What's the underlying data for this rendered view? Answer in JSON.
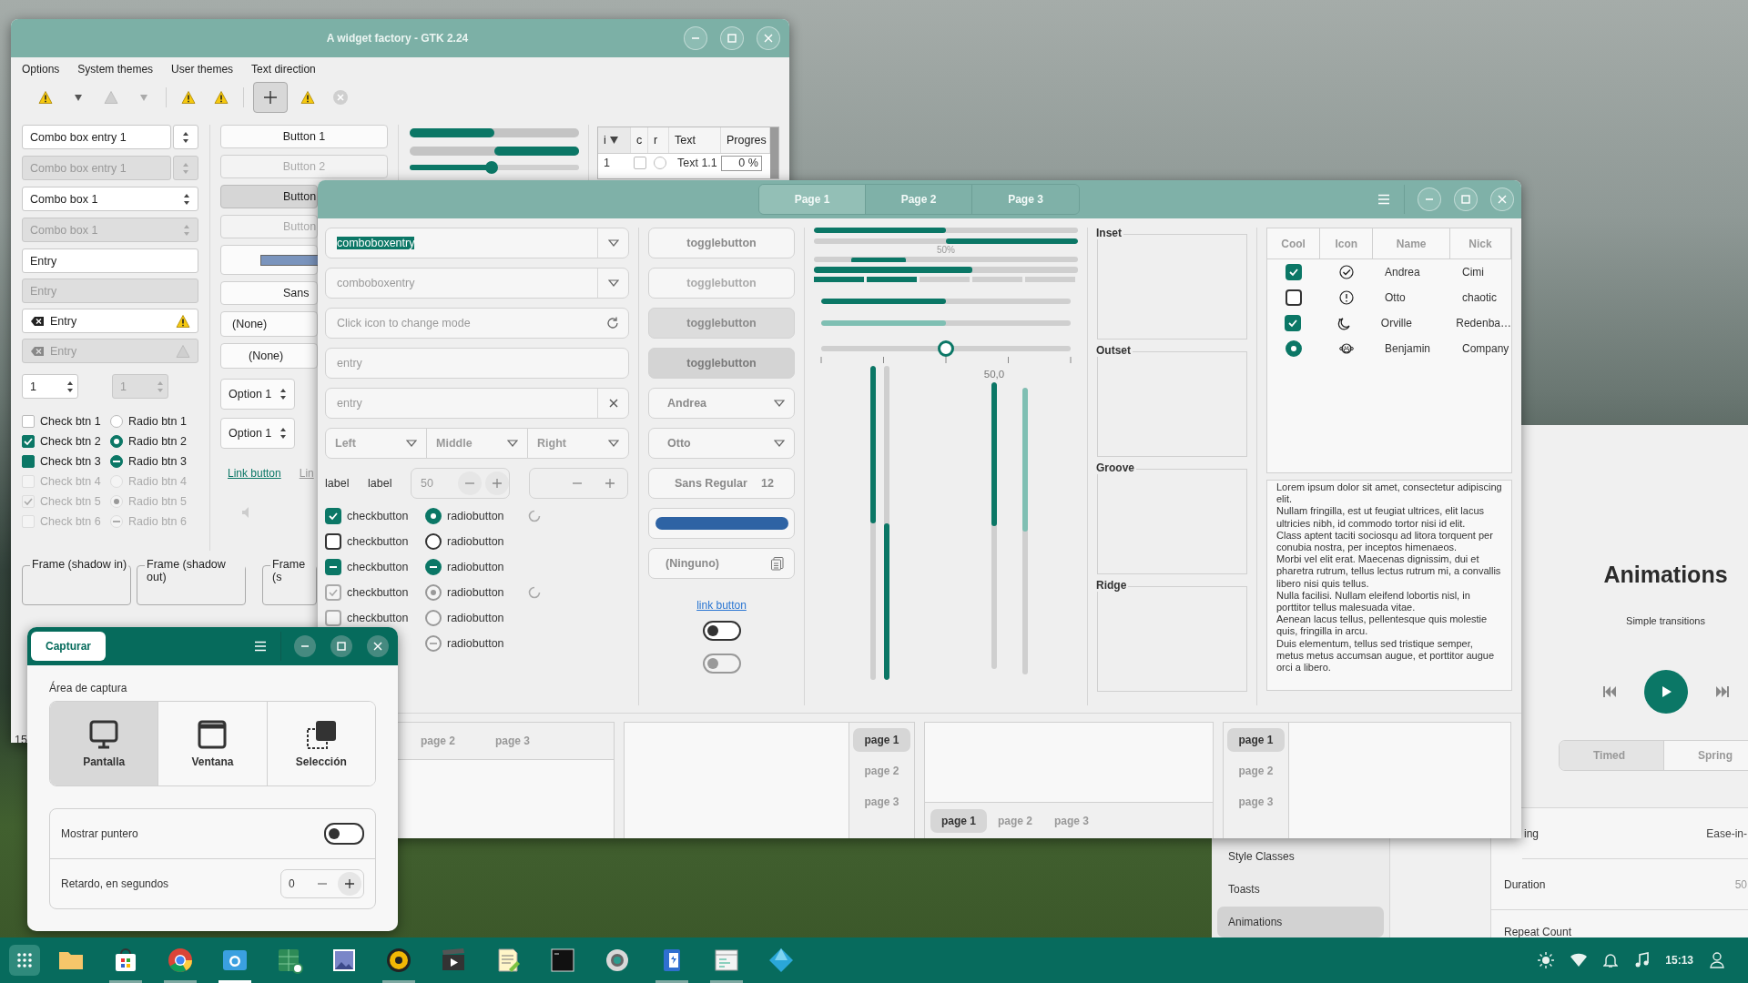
{
  "gtk2_window": {
    "title": "A widget factory - GTK 2.24",
    "menu": [
      "Options",
      "System themes",
      "User themes",
      "Text direction"
    ],
    "combos": [
      {
        "kind": "combo-entry",
        "text": "Combo box entry 1",
        "disabled": false
      },
      {
        "kind": "combo-entry",
        "text": "Combo box entry 1",
        "disabled": true
      },
      {
        "kind": "combo",
        "text": "Combo box 1",
        "disabled": false
      },
      {
        "kind": "combo",
        "text": "Combo box 1",
        "disabled": true
      }
    ],
    "entries": [
      {
        "kind": "plain",
        "text": "Entry",
        "disabled": false
      },
      {
        "kind": "plain",
        "text": "Entry",
        "disabled": true
      },
      {
        "kind": "icons",
        "text": "Entry",
        "disabled": false
      },
      {
        "kind": "icons",
        "text": "Entry",
        "disabled": true
      }
    ],
    "spins": [
      {
        "value": "1",
        "disabled": false
      },
      {
        "value": "1",
        "disabled": true
      }
    ],
    "checks": [
      {
        "kind": "plain",
        "label": "Check btn 1",
        "checked": false,
        "disabled": false
      },
      {
        "kind": "plain",
        "label": "Check btn 2",
        "checked": true,
        "disabled": false
      },
      {
        "kind": "mixed",
        "label": "Check btn 3",
        "disabled": false
      },
      {
        "kind": "plain",
        "label": "Check btn 4",
        "checked": false,
        "disabled": true
      },
      {
        "kind": "plain",
        "label": "Check btn 5",
        "checked": true,
        "disabled": true
      },
      {
        "kind": "plain",
        "label": "Check btn 6",
        "checked": false,
        "disabled": true
      }
    ],
    "radios": [
      {
        "kind": "plain",
        "label": "Radio btn 1",
        "selected": false,
        "disabled": false
      },
      {
        "kind": "plain",
        "label": "Radio btn 2",
        "selected": true,
        "disabled": false
      },
      {
        "kind": "mixed",
        "label": "Radio btn 3",
        "disabled": false
      },
      {
        "kind": "plain",
        "label": "Radio btn 4",
        "selected": false,
        "disabled": true
      },
      {
        "kind": "plain",
        "label": "Radio btn 5",
        "selected": true,
        "disabled": true
      },
      {
        "kind": "mixed",
        "label": "Radio btn 6",
        "disabled": true
      }
    ],
    "buttons": [
      {
        "label": "Button 1",
        "pressed": false,
        "disabled": false
      },
      {
        "label": "Button 2",
        "pressed": false,
        "disabled": true
      },
      {
        "label": "Button",
        "pressed": true,
        "disabled": false
      },
      {
        "label": "Button",
        "pressed": false,
        "disabled": true
      }
    ],
    "font_button": "Sans",
    "choosers": [
      "(None)",
      "(None)"
    ],
    "option_spins": [
      "Option 1",
      "Option 1"
    ],
    "links": [
      {
        "label": "Link button",
        "disabled": false
      },
      {
        "label": "Lin",
        "disabled": true
      }
    ],
    "progress_bars": [
      {
        "level": 0.5,
        "inverted": false
      },
      {
        "level": 0.5,
        "inverted": true
      }
    ],
    "slider": {
      "level": 0.49
    },
    "tree": {
      "columns": [
        {
          "label": "i",
          "sorted": true
        },
        {
          "label": "c",
          "sorted": false
        },
        {
          "label": "r",
          "sorted": false
        },
        {
          "label": "Text",
          "sorted": false
        },
        {
          "label": "Progres",
          "sorted": false
        }
      ],
      "rows": [
        {
          "number": "1",
          "checked": false,
          "selected": false,
          "text": "Text 1.1",
          "progress": "0 %"
        }
      ]
    },
    "frames": [
      "Frame (shadow in)",
      "Frame (shadow out)",
      "Frame (s"
    ],
    "status": "15"
  },
  "gtk3_window": {
    "tabs": [
      {
        "label": "Page 1",
        "selected": true
      },
      {
        "label": "Page 2",
        "selected": false
      },
      {
        "label": "Page 3",
        "selected": false
      }
    ],
    "combo_entries": [
      {
        "text": "comboboxentry",
        "highlighted": true,
        "disabled": false
      },
      {
        "text": "comboboxentry",
        "highlighted": false,
        "disabled": true
      }
    ],
    "mode_entry": {
      "placeholder": "Click icon to change mode"
    },
    "entries": [
      {
        "kind": "plain",
        "placeholder": "entry"
      },
      {
        "kind": "clear",
        "placeholder": "entry"
      }
    ],
    "linked_combos": [
      "Left",
      "Middle",
      "Right"
    ],
    "labels": [
      "label",
      "label"
    ],
    "spins": [
      {
        "value": "50",
        "disabled": false
      },
      {
        "disabled": true
      }
    ],
    "check_rows": [
      {
        "check": {
          "kind": "plain",
          "label": "checkbutton",
          "checked": true,
          "disabled": false
        },
        "radio": {
          "kind": "plain",
          "label": "radiobutton",
          "selected": true,
          "disabled": false
        },
        "spinner": true
      },
      {
        "check": {
          "kind": "plain",
          "label": "checkbutton",
          "checked": false,
          "disabled": false
        },
        "radio": {
          "kind": "plain",
          "label": "radiobutton",
          "selected": false,
          "disabled": false
        },
        "spinner": false
      },
      {
        "check": {
          "kind": "mixed",
          "label": "checkbutton",
          "disabled": false
        },
        "radio": {
          "kind": "mixed",
          "label": "radiobutton",
          "disabled": false
        },
        "spinner": false
      },
      {
        "check": {
          "kind": "plain",
          "label": "checkbutton",
          "checked": true,
          "disabled": true
        },
        "radio": {
          "kind": "plain",
          "label": "radiobutton",
          "selected": true,
          "disabled": true
        },
        "spinner": true
      },
      {
        "check": {
          "kind": "plain",
          "label": "checkbutton",
          "checked": false,
          "disabled": true
        },
        "radio": {
          "kind": "plain",
          "label": "radiobutton",
          "selected": false,
          "disabled": true
        },
        "spinner": false
      },
      {
        "radio": {
          "kind": "mixed",
          "label": "radiobutton",
          "disabled": true
        },
        "spinner": false
      }
    ],
    "toggles": [
      {
        "label": "togglebutton",
        "selected": false,
        "disabled": false
      },
      {
        "label": "togglebutton",
        "selected": false,
        "disabled": true
      },
      {
        "label": "togglebutton",
        "selected": true,
        "disabled": false
      },
      {
        "label": "togglebutton",
        "selected": true,
        "disabled": true
      }
    ],
    "combos": [
      "Andrea",
      "Otto"
    ],
    "font_button": {
      "name": "Sans Regular",
      "size": "12"
    },
    "file_button": "(Ninguno)",
    "link": "link button",
    "switches": [
      {
        "on": false,
        "disabled": false
      },
      {
        "on": false,
        "disabled": true
      }
    ],
    "progress_bars": [
      {
        "level": 0.5,
        "inverted": false
      },
      {
        "level": 0.5,
        "inverted": true
      }
    ],
    "progress_text": "50%",
    "bars": [
      {
        "kind": "progress",
        "level": 0.6
      },
      {
        "kind": "levelbar",
        "level": 0.4
      },
      {
        "kind": "scale",
        "level": 0.5,
        "disabled": false
      },
      {
        "kind": "scale",
        "level": 0.5,
        "disabled": true
      }
    ],
    "slider": {
      "level": 0.5
    },
    "vscales": [
      {
        "level": 0.5,
        "inverted": false,
        "disabled": false
      },
      {
        "level": 0.5,
        "inverted": true,
        "disabled": false
      },
      {
        "level": 0.5,
        "inverted": false,
        "disabled": false
      },
      {
        "level": 0.5,
        "inverted": false,
        "disabled": true
      }
    ],
    "vscale_value": "50,0",
    "frames": [
      "Inset",
      "Outset",
      "Groove",
      "Ridge"
    ],
    "tree": {
      "columns": [
        "Cool",
        "Icon",
        "Name",
        "Nick"
      ],
      "rows": [
        {
          "kind": "check",
          "checked": true,
          "name": "Andrea",
          "nick": "Cimi"
        },
        {
          "kind": "check",
          "checked": false,
          "name": "Otto",
          "nick": "chaotic"
        },
        {
          "kind": "check",
          "checked": true,
          "name": "Orville",
          "nick": "Redenba…"
        },
        {
          "kind": "radio",
          "checked": true,
          "name": "Benjamin",
          "nick": "Company"
        }
      ]
    },
    "text_view": [
      "Lorem ipsum dolor sit amet, consectetur adipiscing elit.",
      "Nullam fringilla, est ut feugiat ultrices, elit lacus ultricies nibh, id commodo tortor nisi id elit.",
      "Class aptent taciti sociosqu ad litora torquent per conubia nostra, per inceptos himenaeos.",
      "Morbi vel elit erat. Maecenas dignissim, dui et pharetra rutrum, tellus lectus rutrum mi, a convallis libero nisi quis tellus.",
      "Nulla facilisi. Nullam eleifend lobortis nisl, in porttitor tellus malesuada vitae.",
      "Aenean lacus tellus, pellentesque quis molestie quis, fringilla in arcu.",
      "Duis elementum, tellus sed tristique semper, metus metus accumsan augue, et porttitor augue orci a libero."
    ],
    "notebooks": [
      {
        "kind": "top",
        "tabs": [
          {
            "label": "page 2",
            "selected": false
          },
          {
            "label": "page 3",
            "selected": false
          }
        ]
      },
      {
        "kind": "right",
        "tabs": [
          {
            "label": "page 1",
            "selected": true
          },
          {
            "label": "page 2",
            "selected": false
          },
          {
            "label": "page 3",
            "selected": false
          }
        ]
      },
      {
        "kind": "bottom",
        "tabs": [
          {
            "label": "page 1",
            "selected": true
          },
          {
            "label": "page 2",
            "selected": false
          },
          {
            "label": "page 3",
            "selected": false
          }
        ]
      },
      {
        "kind": "left",
        "tabs": [
          {
            "label": "page 1",
            "selected": true
          },
          {
            "label": "page 2",
            "selected": false
          },
          {
            "label": "page 3",
            "selected": false
          }
        ]
      }
    ]
  },
  "capture_dialog": {
    "title_button": "Capturar",
    "section": "Área de captura",
    "modes": [
      {
        "kind": "screen",
        "label": "Pantalla",
        "selected": true
      },
      {
        "kind": "window",
        "label": "Ventana",
        "selected": false
      },
      {
        "kind": "selection",
        "label": "Selección",
        "selected": false
      }
    ],
    "options": [
      {
        "kind": "switch",
        "label": "Mostrar puntero",
        "on": false
      },
      {
        "kind": "spin",
        "label": "Retardo, en segundos",
        "value": "0"
      }
    ]
  },
  "demo_app": {
    "heading": "Animations",
    "subtitle": "Simple transitions",
    "modes": [
      {
        "label": "Timed",
        "selected": true
      },
      {
        "label": "Spring",
        "selected": false
      }
    ],
    "sidebar": [
      {
        "label": "Style Classes",
        "selected": false
      },
      {
        "label": "Toasts",
        "selected": false
      },
      {
        "label": "Animations",
        "selected": true
      }
    ],
    "rows": [
      {
        "label": "ing",
        "value": "Ease-in-"
      },
      {
        "label": "Duration",
        "value": "50"
      },
      {
        "label": "Repeat Count"
      }
    ]
  },
  "taskbar": {
    "apps": [
      {
        "kind": "folder",
        "running": false,
        "selected": false
      },
      {
        "kind": "bag",
        "running": true,
        "selected": false
      },
      {
        "kind": "browser",
        "running": true,
        "selected": false
      },
      {
        "kind": "camera",
        "running": true,
        "selected": true
      },
      {
        "kind": "spreadsheet",
        "running": false,
        "selected": false
      },
      {
        "kind": "image",
        "running": false,
        "selected": false
      },
      {
        "kind": "music",
        "running": true,
        "selected": false
      },
      {
        "kind": "video",
        "running": false,
        "selected": false
      },
      {
        "kind": "notes",
        "running": false,
        "selected": false
      },
      {
        "kind": "terminal",
        "running": false,
        "selected": false
      },
      {
        "kind": "gear",
        "running": false,
        "selected": false
      },
      {
        "kind": "phone",
        "running": true,
        "selected": false
      },
      {
        "kind": "window",
        "running": true,
        "selected": false
      },
      {
        "kind": "diamond",
        "running": false,
        "selected": false
      }
    ],
    "clock": "15:13"
  }
}
